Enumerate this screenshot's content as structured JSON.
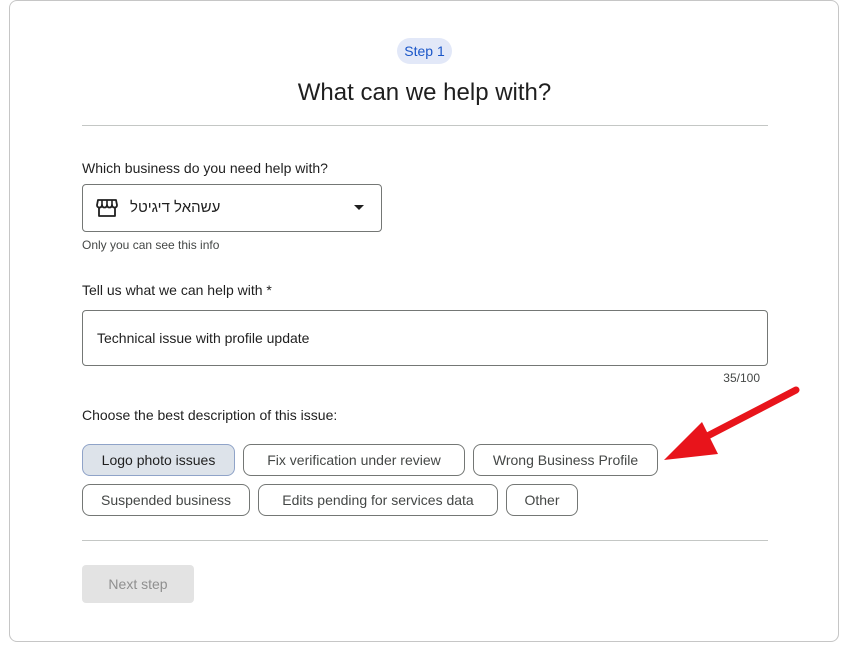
{
  "header": {
    "step_label": "Step 1",
    "title": "What can we help with?"
  },
  "business": {
    "label": "Which business do you need help with?",
    "selected": "עשהאל דיגיטל",
    "icon": "storefront-icon",
    "helper": "Only you can see this info"
  },
  "description": {
    "label": "Tell us what we can help with *",
    "value": "Technical issue with profile update",
    "counter": "35/100"
  },
  "issue": {
    "label": "Choose the best description of this issue:",
    "chips": [
      {
        "label": "Logo photo issues",
        "selected": true
      },
      {
        "label": "Fix verification under review",
        "selected": false
      },
      {
        "label": "Wrong Business Profile",
        "selected": false
      },
      {
        "label": "Suspended business",
        "selected": false
      },
      {
        "label": "Edits pending for services data",
        "selected": false
      },
      {
        "label": "Other",
        "selected": false
      }
    ]
  },
  "footer": {
    "next_label": "Next step"
  },
  "colors": {
    "accent": "#1a56c8",
    "annotation_arrow": "#e8141b"
  }
}
